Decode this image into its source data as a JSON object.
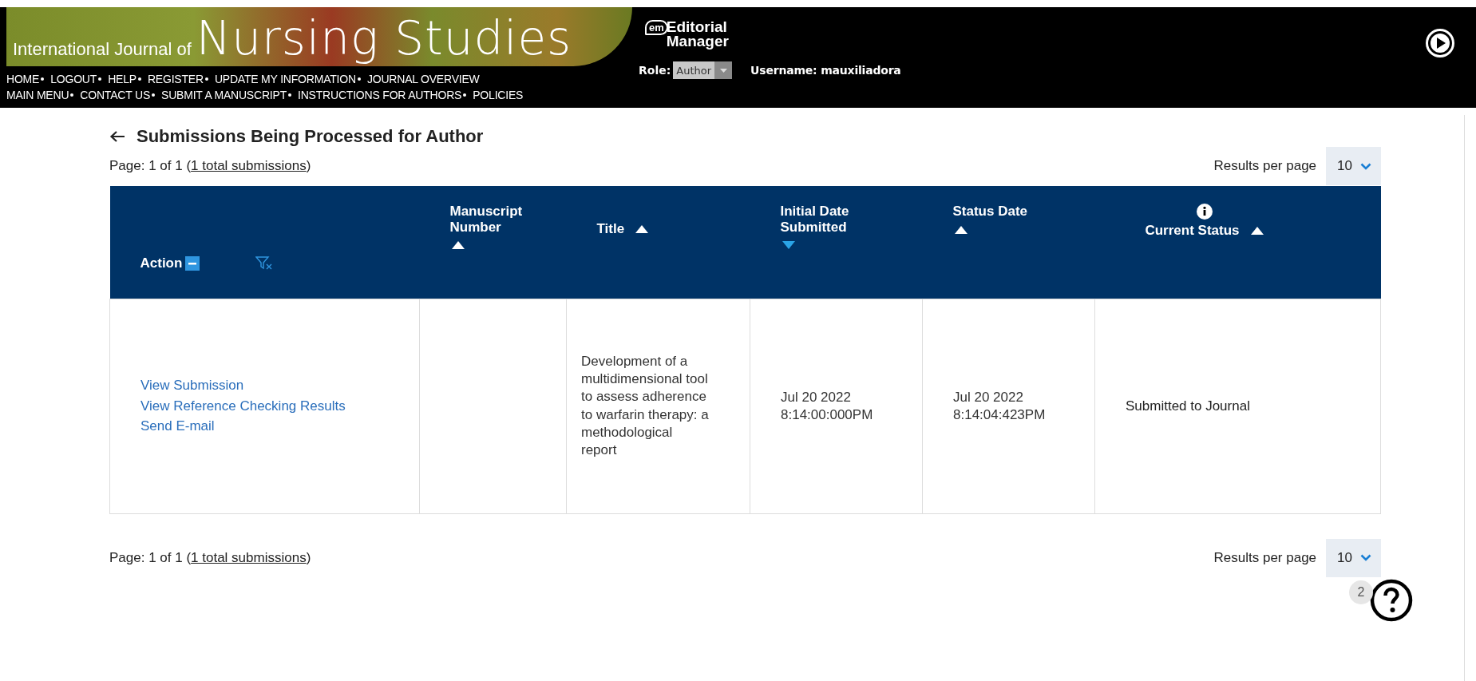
{
  "header": {
    "journal_prefix": "International Journal of",
    "journal_name": "Nursing Studies",
    "logo": {
      "mark": "em",
      "line1": "Editorial",
      "line2": "Manager"
    },
    "nav_rows": [
      [
        "HOME",
        "LOGOUT",
        "HELP",
        "REGISTER",
        "UPDATE MY INFORMATION",
        "JOURNAL OVERVIEW"
      ],
      [
        "MAIN MENU",
        "CONTACT US",
        "SUBMIT A MANUSCRIPT",
        "INSTRUCTIONS FOR AUTHORS",
        "POLICIES"
      ]
    ],
    "role_label": "Role:",
    "role_value": "Author",
    "username": "Username: mauxiliadora"
  },
  "page_title": "Submissions Being Processed for Author",
  "pager_top": {
    "prefix": "Page: 1 of 1 (",
    "link": "1 total submissions",
    "suffix": ")",
    "results_label": "Results per page",
    "results_value": "10"
  },
  "table": {
    "columns": [
      {
        "kind": "action",
        "label": "Action"
      },
      {
        "kind": "sort",
        "label": "Manuscript Number",
        "sorted": false,
        "descending": false
      },
      {
        "kind": "sort",
        "label": "Title",
        "sorted": false,
        "descending": false
      },
      {
        "kind": "sort",
        "label": "Initial Date Submitted",
        "sorted": true,
        "descending": true
      },
      {
        "kind": "sort",
        "label": "Status Date",
        "sorted": false,
        "descending": false
      },
      {
        "kind": "info",
        "label": "Current Status",
        "sorted": false,
        "descending": false
      }
    ],
    "rows": [
      {
        "actions": [
          "View Submission",
          "View Reference Checking Results",
          "Send E-mail"
        ],
        "title": "Development of a multidimensional tool to assess adherence to warfarin therapy: a methodological report",
        "initial_date": [
          "Jul 20 2022",
          "8:14:00:000PM"
        ],
        "status_date": [
          "Jul 20 2022",
          "8:14:04:423PM"
        ],
        "status": "Submitted to Journal"
      }
    ]
  },
  "pager_bottom": {
    "prefix": "Page: 1 of 1 (",
    "link": "1 total submissions",
    "suffix": ")",
    "results_label": "Results per page",
    "results_value": "10"
  },
  "help": {
    "badge": "2"
  }
}
